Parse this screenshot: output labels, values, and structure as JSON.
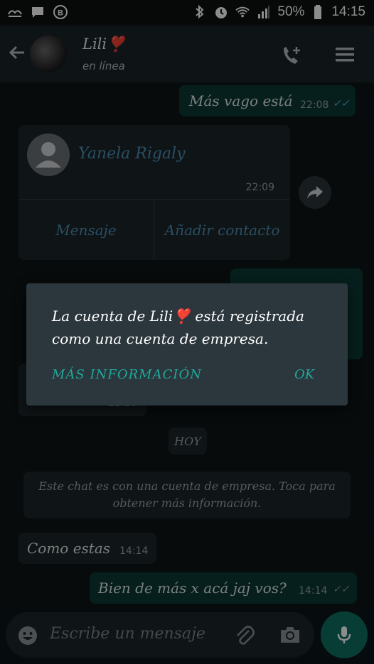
{
  "status_bar": {
    "battery": "50%",
    "time": "14:15"
  },
  "header": {
    "contact_name": "Lili❣️",
    "contact_status": "en línea"
  },
  "messages": {
    "m1": {
      "text": "Más vago está",
      "time": "22:08"
    },
    "contact_card": {
      "name": "Yanela Rigaly",
      "time": "22:09",
      "message_btn": "Mensaje",
      "add_btn": "Añadir contacto"
    },
    "hidden_time": "22:10",
    "day_chip": "HOY",
    "system_note": "Este chat es con una cuenta de empresa. Toca para obtener más información.",
    "m2": {
      "text": "Como estas",
      "time": "14:14"
    },
    "m3": {
      "text": "Bien de más x acá jaj vos?",
      "time": "14:14"
    }
  },
  "dialog": {
    "message": "La cuenta de Lili❣️ está registrada como una cuenta de empresa.",
    "more_label": "MÁS INFORMACIÓN",
    "ok_label": "OK"
  },
  "input": {
    "placeholder": "Escribe un mensaje"
  },
  "colors": {
    "accent": "#1fa89a",
    "outgoing": "#0b3a34",
    "incoming": "#1d2529",
    "link": "#4d8fb3"
  }
}
